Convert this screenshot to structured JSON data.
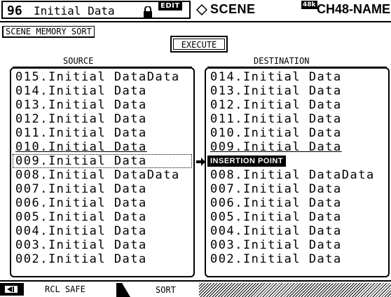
{
  "header": {
    "scene_number": "96",
    "scene_title": "Initial Data",
    "edit_badge": "EDIT",
    "scene_label": "SCENE",
    "rate_badge": "48k",
    "channel": "CH48-NAME"
  },
  "page": {
    "mode_label": "SCENE MEMORY SORT",
    "execute_label": "EXECUTE",
    "source_header": "SOURCE",
    "destination_header": "DESTINATION",
    "insertion_point": "INSERTION POINT"
  },
  "source": [
    "015.Initial DataData",
    "014.Initial Data",
    "013.Initial Data",
    "012.Initial Data",
    "011.Initial Data",
    "010.Initial Data",
    "009.Initial Data",
    "008.Initial DataData",
    "007.Initial Data",
    "006.Initial Data",
    "005.Initial Data",
    "004.Initial Data",
    "003.Initial Data",
    "002.Initial Data"
  ],
  "destination_top": [
    "014.Initial Data",
    "013.Initial Data",
    "012.Initial Data",
    "011.Initial Data",
    "010.Initial Data",
    "009.Initial Data"
  ],
  "destination_bottom": [
    "008.Initial DataData",
    "007.Initial Data",
    "006.Initial Data",
    "005.Initial Data",
    "004.Initial Data",
    "003.Initial Data",
    "002.Initial Data"
  ],
  "tabs": {
    "rcl_safe": "RCL SAFE",
    "sort": "SORT"
  },
  "icons": {
    "lock": "lock-icon",
    "diamond": "diamond-icon",
    "arrow": "right-arrow-icon",
    "tab_nav": "left-arrow-icon"
  }
}
